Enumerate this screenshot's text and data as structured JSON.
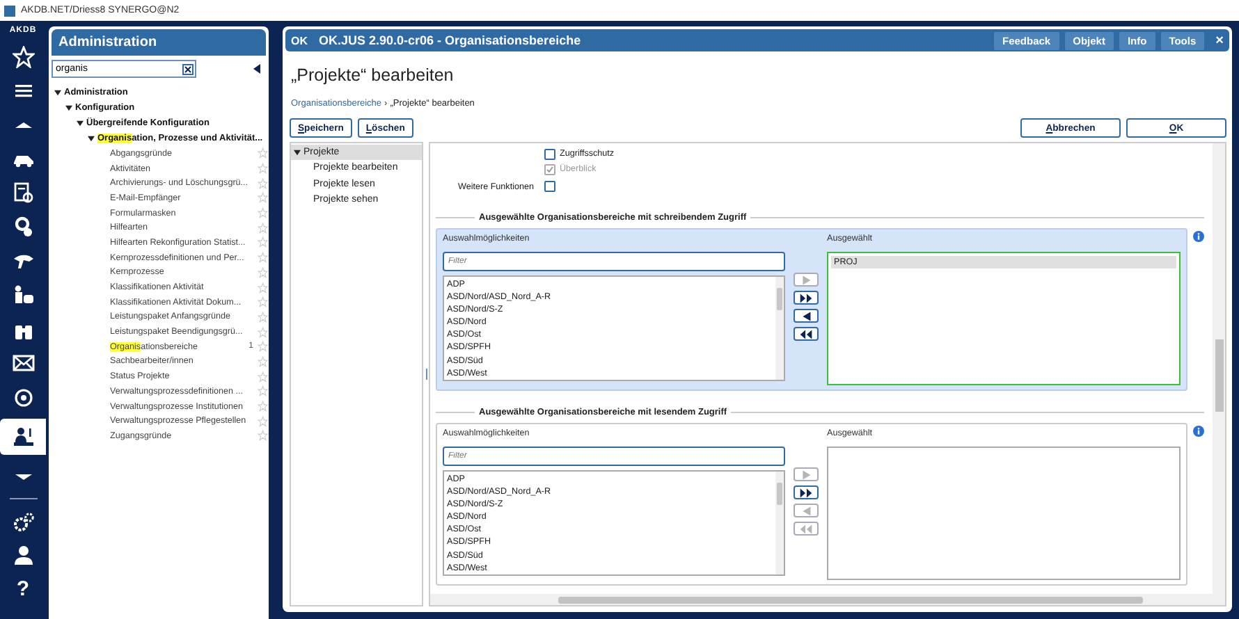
{
  "app_bar": {
    "title": "AKDB.NET/Driess8 SYNERGO@N2"
  },
  "rail": {
    "logo": "AKDB",
    "items": [
      {
        "kind": "star",
        "selected": false
      },
      {
        "kind": "menu",
        "selected": false
      },
      {
        "kind": "caret-up",
        "selected": false
      },
      {
        "kind": "car",
        "selected": false
      },
      {
        "kind": "document",
        "selected": false
      },
      {
        "kind": "gear",
        "selected": false
      },
      {
        "kind": "hand",
        "selected": false
      },
      {
        "kind": "phone",
        "selected": false
      },
      {
        "kind": "binoculars",
        "selected": false
      },
      {
        "kind": "mail",
        "selected": false
      },
      {
        "kind": "target",
        "selected": false
      },
      {
        "kind": "desk",
        "selected": true
      },
      {
        "kind": "caret-down",
        "selected": false
      },
      {
        "kind": "divider"
      },
      {
        "kind": "gears",
        "selected": false
      },
      {
        "kind": "person",
        "selected": false
      },
      {
        "kind": "text",
        "label": "?",
        "selected": false
      }
    ]
  },
  "admin": {
    "title": "Administration",
    "search": {
      "value": "organis"
    },
    "tree": [
      {
        "label": "Administration",
        "expanded": true,
        "children": [
          {
            "label": "Konfiguration",
            "expanded": true,
            "children": [
              {
                "label": "Übergreifende Konfiguration",
                "expanded": true,
                "children": [
                  {
                    "highlight": "Organis",
                    "label": "ation, Prozesse und Aktivität...",
                    "expanded": true,
                    "children": [
                      {
                        "label": "Abgangsgründe"
                      },
                      {
                        "label": "Aktivitäten"
                      },
                      {
                        "label": "Archivierungs- und Löschungsgrü..."
                      },
                      {
                        "label": "E-Mail-Empfänger"
                      },
                      {
                        "label": "Formularmasken"
                      },
                      {
                        "label": "Hilfearten"
                      },
                      {
                        "label": "Hilfearten Rekonfiguration Statist..."
                      },
                      {
                        "label": "Kernprozessdefinitionen und Per..."
                      },
                      {
                        "label": "Kernprozesse"
                      },
                      {
                        "label": "Klassifikationen Aktivität"
                      },
                      {
                        "label": "Klassifikationen Aktivität Dokum..."
                      },
                      {
                        "label": "Leistungspaket Anfangsgründe"
                      },
                      {
                        "label": "Leistungspaket Beendigungsgrü..."
                      },
                      {
                        "highlight": "Organis",
                        "label": "ationsbereiche",
                        "count": "1"
                      },
                      {
                        "label": "Sachbearbeiter/innen"
                      },
                      {
                        "label": "Status Projekte"
                      },
                      {
                        "label": "Verwaltungsprozessdefinitionen ..."
                      },
                      {
                        "label": "Verwaltungsprozesse Institutionen"
                      },
                      {
                        "label": "Verwaltungsprozesse Pflegestellen"
                      },
                      {
                        "label": "Zugangsgründe"
                      }
                    ]
                  }
                ]
              }
            ]
          }
        ]
      }
    ]
  },
  "window": {
    "logo": "OK",
    "title": "OK.JUS 2.90.0-cr06 - Organisationsbereiche",
    "header_buttons": [
      "Feedback",
      "Objekt",
      "Info",
      "Tools"
    ],
    "close": "×",
    "page_title": "„Projekte“ bearbeiten",
    "breadcrumb": {
      "link": "Organisationsbereiche",
      "separator": "›",
      "current": "„Projekte“ bearbeiten"
    },
    "left_buttons": [
      "Speichern",
      "Löschen"
    ],
    "right_buttons": [
      "Abbrechen",
      "OK"
    ],
    "nav": [
      {
        "label": "Projekte",
        "expanded": true,
        "selected": true,
        "children": [
          {
            "label": "Projekte bearbeiten",
            "selected": false
          },
          {
            "label": "Projekte lesen",
            "selected": false
          },
          {
            "label": "Projekte sehen",
            "selected": false
          }
        ]
      }
    ],
    "checkboxes": [
      {
        "label": "Zugriffsschutz",
        "checked": false,
        "disabled": false
      },
      {
        "label": "Überblick",
        "checked": true,
        "disabled": true
      }
    ],
    "more": {
      "label": "Weitere Funktionen",
      "checked": false
    },
    "sections": [
      {
        "title": "Ausgewählte Organisationsbereiche mit schreibendem Zugriff",
        "focused": true,
        "available_label": "Auswahlmöglichkeiten",
        "filter": {
          "placeholder": "Filter"
        },
        "options": [
          "ADP",
          "ASD/Nord/ASD_Nord_A-R",
          "ASD/Nord/S-Z",
          "ASD/Nord",
          "ASD/Ost",
          "ASD/SPFH",
          "ASD/Süd",
          "ASD/West"
        ],
        "selected_label": "Ausgewählt",
        "chosen": [
          {
            "label": "PROJ",
            "selected": true
          }
        ],
        "buttons": [
          {
            "kind": "add",
            "disabled": true
          },
          {
            "kind": "add-all",
            "disabled": false
          },
          {
            "kind": "remove",
            "disabled": false
          },
          {
            "kind": "remove-all",
            "disabled": false
          }
        ]
      },
      {
        "title": "Ausgewählte Organisationsbereiche mit lesendem Zugriff",
        "focused": false,
        "available_label": "Auswahlmöglichkeiten",
        "filter": {
          "placeholder": "Filter"
        },
        "options": [
          "ADP",
          "ASD/Nord/ASD_Nord_A-R",
          "ASD/Nord/S-Z",
          "ASD/Nord",
          "ASD/Ost",
          "ASD/SPFH",
          "ASD/Süd",
          "ASD/West"
        ],
        "selected_label": "Ausgewählt",
        "buttons": [
          {
            "kind": "add",
            "disabled": true
          },
          {
            "kind": "add-all",
            "disabled": false
          },
          {
            "kind": "remove",
            "disabled": true
          },
          {
            "kind": "remove-all",
            "disabled": true
          }
        ]
      }
    ]
  }
}
